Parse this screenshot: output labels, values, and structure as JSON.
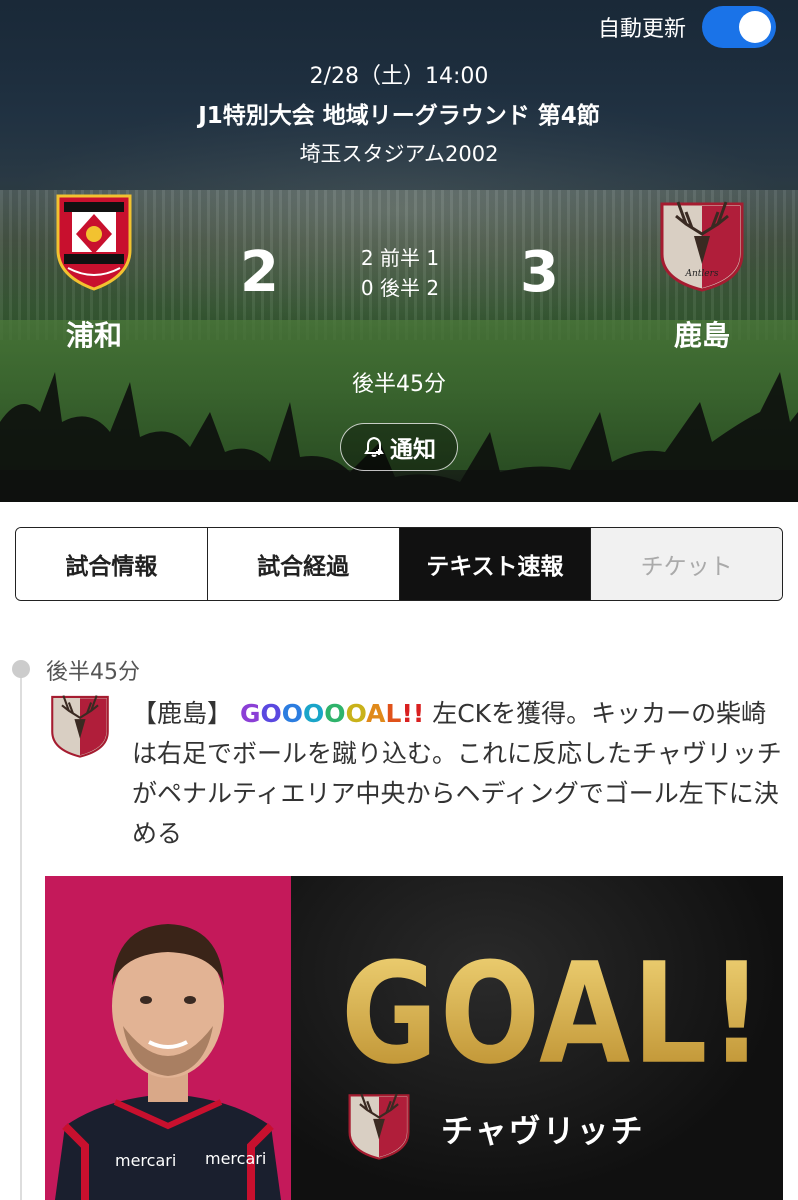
{
  "header": {
    "auto_update_label": "自動更新",
    "auto_update_on": true,
    "date": "2/28（土）14:00",
    "competition": "J1特別大会 地域リーグラウンド 第4節",
    "venue": "埼玉スタジアム2002"
  },
  "match": {
    "home": {
      "name": "浦和",
      "score": "2",
      "logo": "urawa-red-diamonds-crest-icon"
    },
    "away": {
      "name": "鹿島",
      "score": "3",
      "logo": "kashima-antlers-crest-icon"
    },
    "first_half": "2 前半 1",
    "second_half": "0 後半 2",
    "status": "後半45分",
    "notify_label": "通知"
  },
  "tabs": [
    {
      "label": "試合情報",
      "state": "default"
    },
    {
      "label": "試合経過",
      "state": "default"
    },
    {
      "label": "テキスト速報",
      "state": "active"
    },
    {
      "label": "チケット",
      "state": "disabled"
    }
  ],
  "timeline": {
    "event": {
      "time": "後半45分",
      "team_tag": "【鹿島】",
      "goal_text": "GOOOOOAL!!",
      "description": "左CKを獲得。キッカーの柴崎は右足でボールを蹴り込む。これに反応したチャヴリッチがペナルティエリア中央からヘディングでゴール左下に決める"
    },
    "card": {
      "headline": "GOAL!",
      "scorer": "チャヴリッチ",
      "sponsor": "mercari"
    }
  },
  "colors": {
    "toggle_on": "#1a73e8",
    "active_tab": "#111111",
    "card_player_bg": "#c4195a",
    "goal_gold": "#d9b14a"
  }
}
